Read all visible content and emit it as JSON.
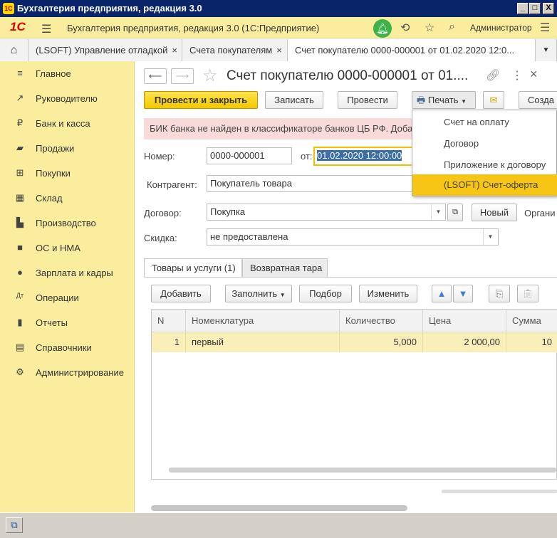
{
  "window": {
    "title": "Бухгалтерия предприятия, редакция 3.0",
    "logo": "1С",
    "min": "_",
    "max": "□",
    "close": "X"
  },
  "app": {
    "logo": "1С",
    "title": "Бухгалтерия предприятия, редакция 3.0  (1С:Предприятие)",
    "user": "Администратор",
    "icons": [
      "bell-icon",
      "history-icon",
      "star-icon",
      "search-icon",
      "menu-icon"
    ]
  },
  "tabs": [
    {
      "label": "(LSOFT) Управление отладкой",
      "close": "×"
    },
    {
      "label": "Счета покупателям",
      "close": "×"
    },
    {
      "label": "Счет покупателю 0000-000001 от 01.02.2020 12:0...",
      "close": "×"
    }
  ],
  "sidebar": {
    "items": [
      {
        "label": "Главное",
        "icon": "≡"
      },
      {
        "label": "Руководителю",
        "icon": "↗"
      },
      {
        "label": "Банк и касса",
        "icon": "₽"
      },
      {
        "label": "Продажи",
        "icon": "▰"
      },
      {
        "label": "Покупки",
        "icon": "⊞"
      },
      {
        "label": "Склад",
        "icon": "▦"
      },
      {
        "label": "Производство",
        "icon": "▙"
      },
      {
        "label": "ОС и НМА",
        "icon": "■"
      },
      {
        "label": "Зарплата и кадры",
        "icon": "●"
      },
      {
        "label": "Операции",
        "icon": "Дт"
      },
      {
        "label": "Отчеты",
        "icon": "▮"
      },
      {
        "label": "Справочники",
        "icon": "▤"
      },
      {
        "label": "Администрирование",
        "icon": "⚙"
      }
    ]
  },
  "form": {
    "title": "Счет покупателю 0000-000001 от 01....",
    "buttons": {
      "post_close": "Провести и закрыть",
      "save": "Записать",
      "post": "Провести",
      "print": "Печать",
      "create": "Созда"
    },
    "banner": "БИК банка не найден в классификаторе банков ЦБ РФ. Доба",
    "fields": {
      "number_label": "Номер:",
      "number_value": "0000-000001",
      "date_label": "от:",
      "date_value": "01.02.2020 12:00:00",
      "counterparty_label": "Контрагент:",
      "counterparty_value": "Покупатель товара",
      "contract_label": "Договор:",
      "contract_value": "Покупка",
      "new_button": "Новый",
      "org_label": "Органи",
      "discount_label": "Скидка:",
      "discount_value": "не предоставлена"
    },
    "doc_tabs": [
      "Товары и услуги (1)",
      "Возвратная тара"
    ],
    "table_toolbar": {
      "add": "Добавить",
      "fill": "Заполнить",
      "pick": "Подбор",
      "change": "Изменить"
    },
    "table": {
      "columns": [
        "N",
        "Номенклатура",
        "Количество",
        "Цена",
        "Сумма"
      ],
      "rows": [
        [
          "1",
          "первый",
          "5,000",
          "2 000,00",
          "10"
        ]
      ]
    }
  },
  "print_menu": {
    "items": [
      "Счет на оплату",
      "Договор",
      "Приложение к договору",
      "(LSOFT) Счет-оферта"
    ],
    "selected_index": 3
  },
  "colors": {
    "sidebar_bg": "#fbed9e",
    "accent_yellow": "#f6c515",
    "banner_bg": "#f8dada",
    "titlebar": "#0a246a"
  }
}
